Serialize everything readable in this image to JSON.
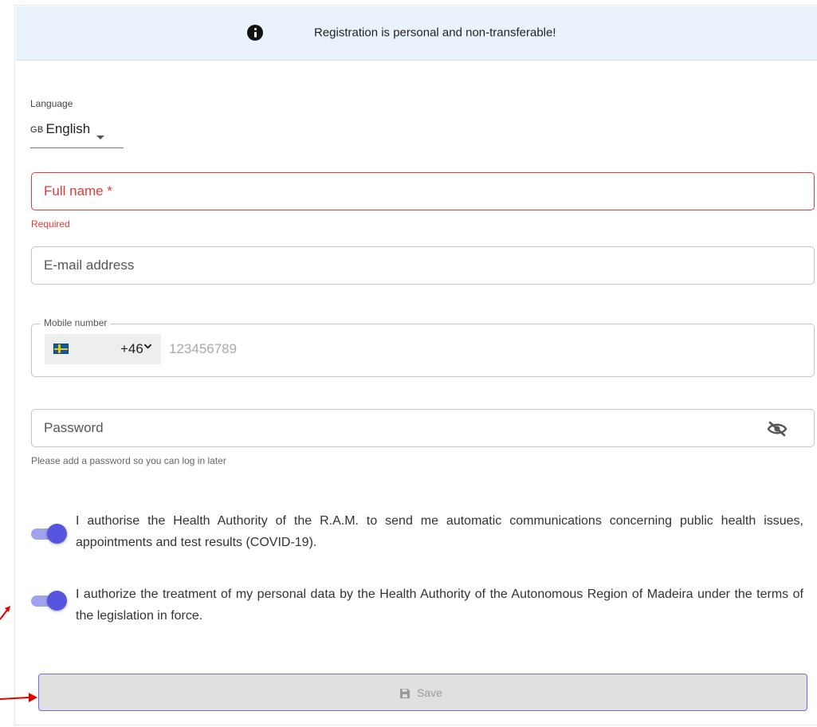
{
  "banner": {
    "icon": "info-circle-icon",
    "text": "Registration is personal and non-transferable!"
  },
  "language": {
    "label": "Language",
    "country_code": "GB",
    "value": "English"
  },
  "full_name": {
    "placeholder": "Full name *",
    "error": "Required"
  },
  "email": {
    "placeholder": "E-mail address"
  },
  "mobile": {
    "label": "Mobile number",
    "flag": "sweden-flag-icon",
    "dial_code": "+46",
    "placeholder": "123456789"
  },
  "password": {
    "placeholder": "Password",
    "helper": "Please add a password so you can log in later",
    "visibility_icon": "eye-off-icon"
  },
  "consents": [
    {
      "text": "I authorise the Health Authority of the R.A.M. to send me automatic communications concerning public health issues, appointments and test results (COVID-19).",
      "checked": true
    },
    {
      "text": "I authorize the treatment of my personal data by the Health Authority of the Autonomous Region of Madeira under the terms of the legislation in force.",
      "checked": true
    }
  ],
  "save_button": {
    "label": "Save",
    "icon": "floppy-disk-icon"
  },
  "colors": {
    "accent": "#5555e0",
    "error": "#e53935",
    "banner_bg": "#eaf3fb",
    "annotation": "#e00000"
  }
}
